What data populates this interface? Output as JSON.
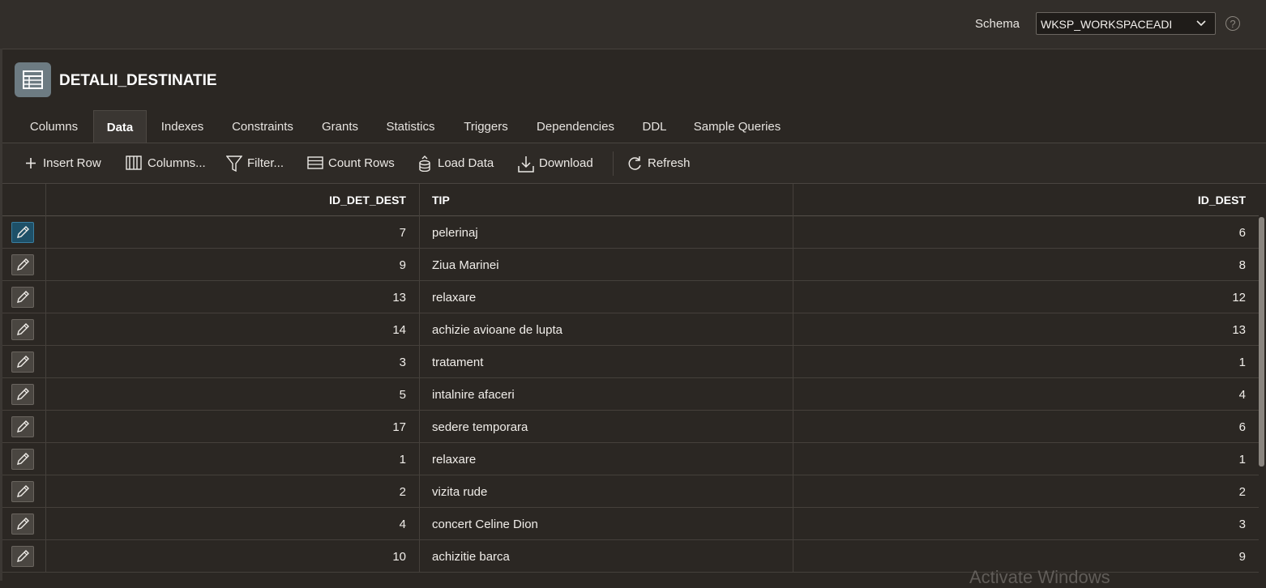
{
  "topbar": {
    "schema_label": "Schema",
    "schema_value": "WKSP_WORKSPACEADI",
    "help_symbol": "?"
  },
  "header": {
    "title": "DETALII_DESTINATIE",
    "icon": "table-icon"
  },
  "tabs": [
    {
      "label": "Columns",
      "active": false
    },
    {
      "label": "Data",
      "active": true
    },
    {
      "label": "Indexes",
      "active": false
    },
    {
      "label": "Constraints",
      "active": false
    },
    {
      "label": "Grants",
      "active": false
    },
    {
      "label": "Statistics",
      "active": false
    },
    {
      "label": "Triggers",
      "active": false
    },
    {
      "label": "Dependencies",
      "active": false
    },
    {
      "label": "DDL",
      "active": false
    },
    {
      "label": "Sample Queries",
      "active": false
    }
  ],
  "toolbar": {
    "insert_row": "Insert Row",
    "columns": "Columns...",
    "filter": "Filter...",
    "count_rows": "Count Rows",
    "load_data": "Load Data",
    "download": "Download",
    "refresh": "Refresh"
  },
  "grid": {
    "columns": [
      "ID_DET_DEST",
      "TIP",
      "ID_DEST"
    ],
    "rows": [
      [
        "7",
        "pelerinaj",
        "6"
      ],
      [
        "9",
        "Ziua Marinei",
        "8"
      ],
      [
        "13",
        "relaxare",
        "12"
      ],
      [
        "14",
        "achizie avioane de lupta",
        "13"
      ],
      [
        "3",
        "tratament",
        "1"
      ],
      [
        "5",
        "intalnire afaceri",
        "4"
      ],
      [
        "17",
        "sedere temporara",
        "6"
      ],
      [
        "1",
        "relaxare",
        "1"
      ],
      [
        "2",
        "vizita rude",
        "2"
      ],
      [
        "4",
        "concert Celine Dion",
        "3"
      ],
      [
        "10",
        "achizitie barca",
        "9"
      ]
    ]
  },
  "watermark": "Activate Windows",
  "colors": {
    "background": "#2b2723",
    "topbar": "#322e2a",
    "focus_edit": "#1e5068"
  }
}
